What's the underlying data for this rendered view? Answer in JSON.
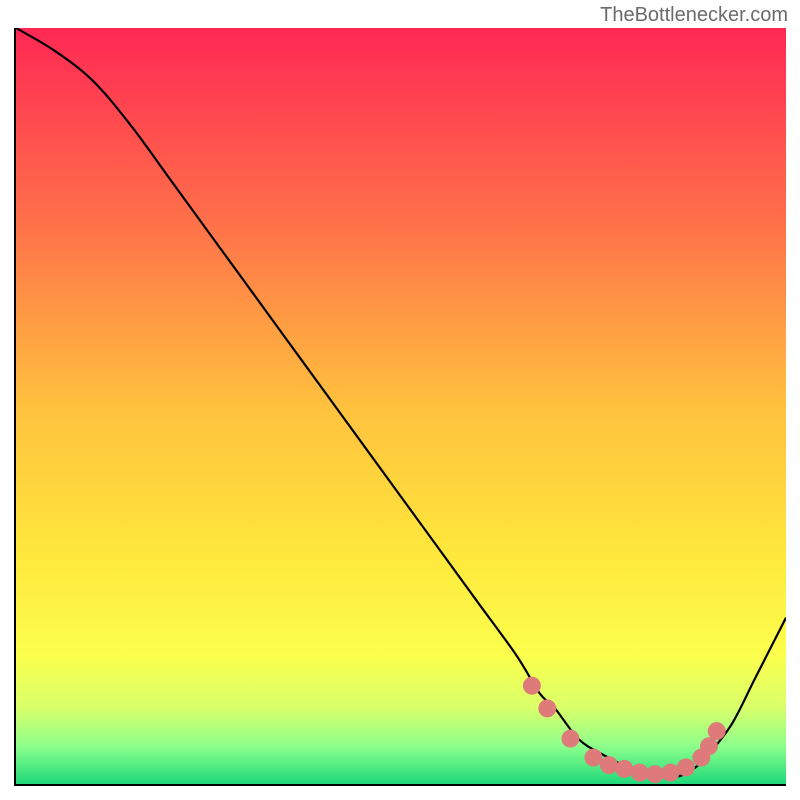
{
  "watermark": "TheBottlenecker.com",
  "chart_data": {
    "type": "line",
    "title": "",
    "xlabel": "",
    "ylabel": "",
    "xlim": [
      0,
      100
    ],
    "ylim": [
      0,
      100
    ],
    "series": [
      {
        "name": "bottleneck-curve",
        "x": [
          0,
          5,
          10,
          15,
          20,
          25,
          30,
          35,
          40,
          45,
          50,
          55,
          60,
          65,
          68,
          70,
          73,
          76,
          80,
          84,
          86,
          88,
          90,
          93,
          96,
          100
        ],
        "y": [
          100,
          97,
          93,
          87,
          80,
          73,
          66,
          59,
          52,
          45,
          38,
          31,
          24,
          17,
          12,
          10,
          6,
          4,
          2,
          1,
          1,
          2,
          4,
          8,
          14,
          22
        ]
      }
    ],
    "highlight_points": {
      "name": "bottleneck-dots",
      "color": "#de7a7a",
      "points": [
        {
          "x": 67,
          "y": 13
        },
        {
          "x": 69,
          "y": 10
        },
        {
          "x": 72,
          "y": 6
        },
        {
          "x": 75,
          "y": 3.5
        },
        {
          "x": 77,
          "y": 2.5
        },
        {
          "x": 79,
          "y": 2
        },
        {
          "x": 81,
          "y": 1.5
        },
        {
          "x": 83,
          "y": 1.3
        },
        {
          "x": 85,
          "y": 1.5
        },
        {
          "x": 87,
          "y": 2.2
        },
        {
          "x": 89,
          "y": 3.5
        },
        {
          "x": 90,
          "y": 5
        },
        {
          "x": 91,
          "y": 7
        }
      ]
    },
    "gradient": {
      "stops": [
        {
          "offset": 0,
          "color": "#ff2854"
        },
        {
          "offset": 0.25,
          "color": "#ff6e4a"
        },
        {
          "offset": 0.5,
          "color": "#ffc13e"
        },
        {
          "offset": 0.7,
          "color": "#ffe83c"
        },
        {
          "offset": 0.83,
          "color": "#fcff4d"
        },
        {
          "offset": 0.9,
          "color": "#d8ff6a"
        },
        {
          "offset": 0.95,
          "color": "#8cff8c"
        },
        {
          "offset": 1.0,
          "color": "#1fd97a"
        }
      ]
    }
  }
}
